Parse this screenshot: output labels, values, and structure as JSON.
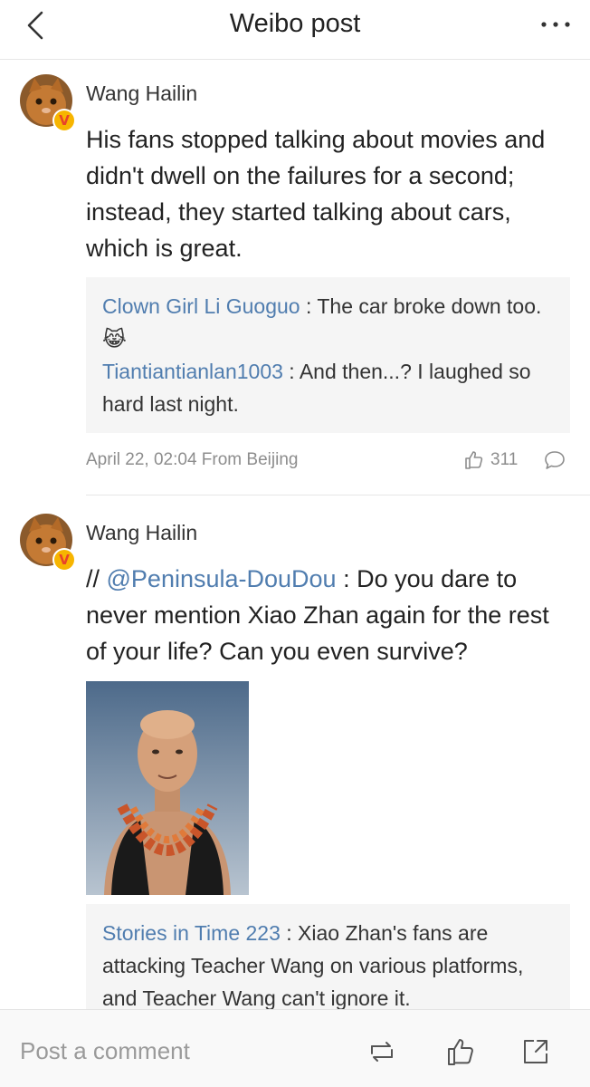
{
  "header": {
    "title": "Weibo post",
    "back_icon": "chevron-left-icon",
    "more_icon": "more-dots-icon"
  },
  "posts": [
    {
      "username": "Wang Hailin",
      "badge": "V",
      "text": "His fans stopped talking about movies and didn't dwell on the failures for a second; instead, they started talking about cars, which is great.",
      "comments": [
        {
          "user": "Clown Girl Li Guoguo",
          "sep": " : ",
          "text": "The car broke down too.",
          "emoji": "😹"
        },
        {
          "user": "Tiantiantianlan1003",
          "sep": " : ",
          "text": "And then...? I laughed so hard last night."
        }
      ],
      "meta": "April 22, 02:04 From Beijing",
      "likes": "311"
    },
    {
      "username": "Wang Hailin",
      "badge": "V",
      "prefix": "// ",
      "mention": "@Peninsula-DouDou",
      "sep": " : ",
      "text": "Do you dare to never mention Xiao Zhan again for the rest of your life? Can you even survive?",
      "comments": [
        {
          "user": "Stories in Time 223",
          "sep": " : ",
          "text": "Xiao Zhan's fans are attacking Teacher Wang on various platforms, and Teacher Wang can't ignore it."
        }
      ]
    }
  ],
  "bottom_bar": {
    "placeholder": "Post a comment",
    "icons": [
      "repost-icon",
      "like-icon",
      "share-icon"
    ]
  },
  "colors": {
    "link": "#507daf",
    "badge_bg": "#f7b500",
    "badge_fg": "#e8422a",
    "meta": "#8d8d8d"
  }
}
